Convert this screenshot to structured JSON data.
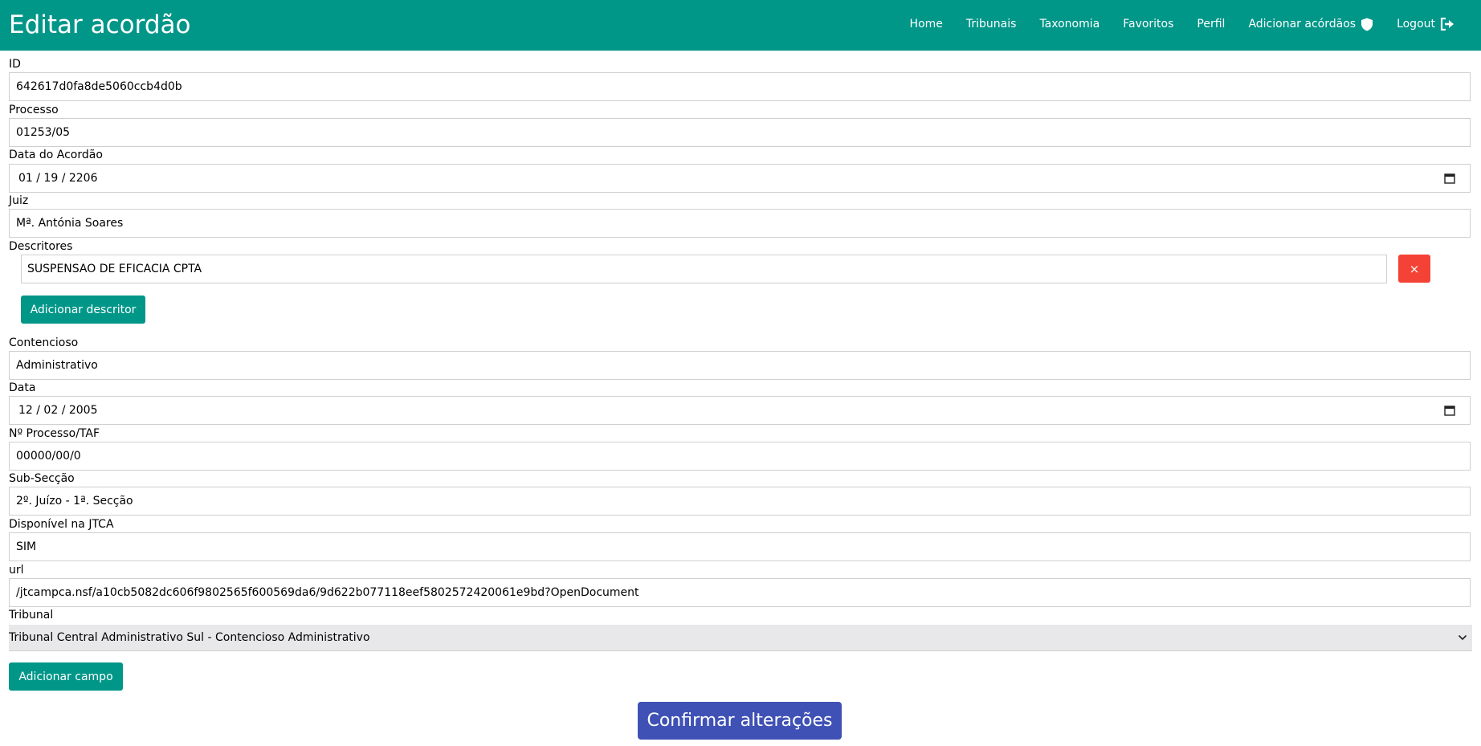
{
  "header": {
    "title": "Editar acordão",
    "nav": [
      {
        "label": "Home"
      },
      {
        "label": "Tribunais"
      },
      {
        "label": "Taxonomia"
      },
      {
        "label": "Favoritos"
      },
      {
        "label": "Perfil"
      },
      {
        "label": "Adicionar acórdãos",
        "icon": "shield-icon"
      },
      {
        "label": "Logout",
        "icon": "logout-icon"
      }
    ]
  },
  "form": {
    "id": {
      "label": "ID",
      "value": "642617d0fa8de5060ccb4d0b"
    },
    "processo": {
      "label": "Processo",
      "value": "01253/05"
    },
    "data_acordao": {
      "label": "Data do Acordão",
      "value": "01 / 19 / 2206"
    },
    "juiz": {
      "label": "Juiz",
      "value": "Mª. Antónia Soares"
    },
    "descritores": {
      "label": "Descritores",
      "items": [
        {
          "value": "SUSPENSAO DE EFICACIA CPTA",
          "remove_label": "×"
        }
      ],
      "add_label": "Adicionar descritor"
    },
    "contencioso": {
      "label": "Contencioso",
      "value": "Administrativo"
    },
    "data": {
      "label": "Data",
      "value": "12 / 02 / 2005"
    },
    "processo_taf": {
      "label": "Nº Processo/TAF",
      "value": "00000/00/0"
    },
    "sub_seccao": {
      "label": "Sub-Secção",
      "value": "2º. Juízo - 1ª. Secção"
    },
    "disponivel": {
      "label": "Disponível na JTCA",
      "value": "SIM"
    },
    "url": {
      "label": "url",
      "value": "/jtcampca.nsf/a10cb5082dc606f9802565f600569da6/9d622b077118eef5802572420061e9bd?OpenDocument"
    },
    "tribunal": {
      "label": "Tribunal",
      "selected": "Tribunal Central Administrativo Sul - Contencioso Administrativo"
    },
    "add_field_label": "Adicionar campo",
    "confirm_label": "Confirmar alterações"
  },
  "colors": {
    "header": "#009688",
    "danger": "#f44336",
    "primary": "#3f51b5",
    "select_bg": "#e8e8ea"
  }
}
